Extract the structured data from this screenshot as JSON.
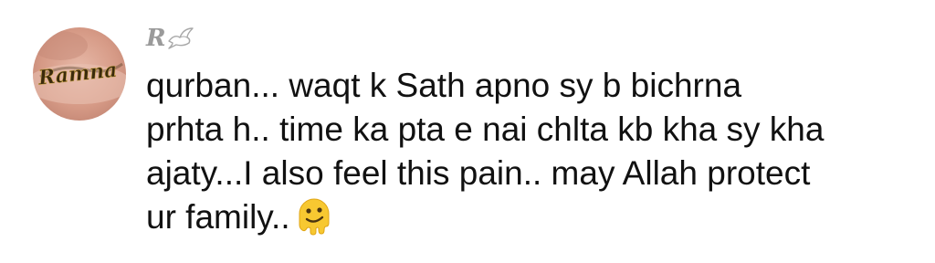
{
  "comment": {
    "author": {
      "name": "R",
      "decoration_icon": "dove-icon"
    },
    "avatar": {
      "label": "Ramna"
    },
    "lines": [
      "qurban... waqt k Sath apno sy b bichrna",
      "prhta h.. time ka pta e nai chlta kb kha sy kha",
      "ajaty...I also feel this pain.. may Allah protect",
      "ur family.."
    ],
    "trailing_emoji": "melting-face-icon"
  }
}
